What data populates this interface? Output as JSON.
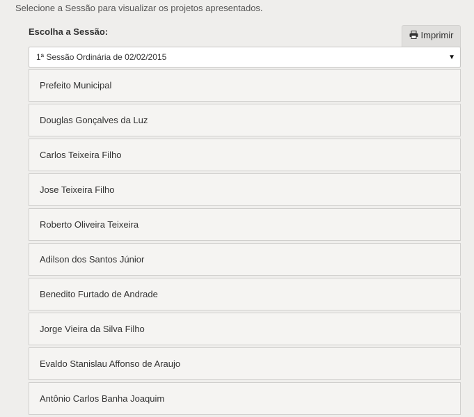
{
  "intro_text": "Selecione a Sessão para visualizar os projetos apresentados.",
  "session_label": "Escolha a Sessão:",
  "print_button_label": "Imprimir",
  "print_icon": "printer-icon",
  "session_select": {
    "selected": "1ª Sessão Ordinária de 02/02/2015",
    "arrow": "▼"
  },
  "members": [
    "Prefeito Municipal",
    "Douglas Gonçalves da Luz",
    "Carlos Teixeira Filho",
    "Jose Teixeira Filho",
    "Roberto Oliveira Teixeira",
    "Adilson dos Santos Júnior",
    "Benedito Furtado de Andrade",
    "Jorge Vieira da Silva Filho",
    "Evaldo Stanislau Affonso de Araujo",
    "Antônio Carlos Banha Joaquim"
  ]
}
